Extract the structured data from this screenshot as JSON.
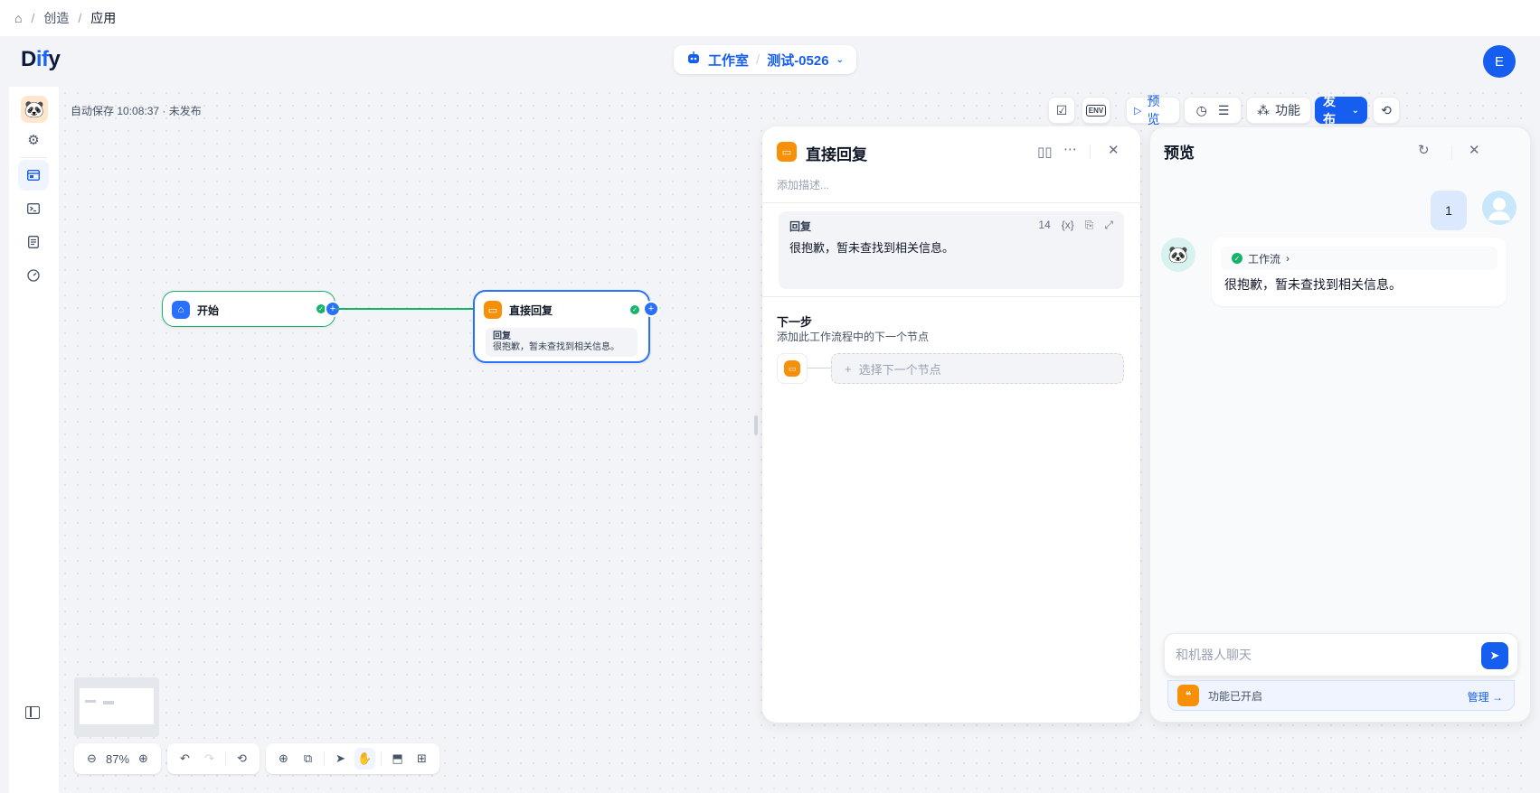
{
  "breadcrumb": {
    "home_icon": "home-icon",
    "items": [
      "创造",
      "应用"
    ]
  },
  "header": {
    "logo_pre": "D",
    "logo_accent": "if",
    "logo_post": "y",
    "studio_label": "工作室",
    "app_name": "测试-0526",
    "user_initial": "E"
  },
  "canvas": {
    "autosave_text": "自动保存 10:08:37 · 未发布"
  },
  "toolbar": {
    "env_label": "ENV",
    "preview_label": "预览",
    "features_label": "功能",
    "publish_label": "发布"
  },
  "nodes": {
    "start": {
      "title": "开始"
    },
    "reply": {
      "title": "直接回复",
      "body_label": "回复",
      "body_text": "很抱歉，暂未查找到相关信息。"
    }
  },
  "controls": {
    "zoom": "87%"
  },
  "node_panel": {
    "title": "直接回复",
    "desc_placeholder": "添加描述...",
    "reply_label": "回复",
    "reply_count": "14",
    "var_label": "{x}",
    "reply_text": "很抱歉，暂未查找到相关信息。",
    "next_title": "下一步",
    "next_sub": "添加此工作流程中的下一个节点",
    "next_btn": "选择下一个节点"
  },
  "preview": {
    "title": "预览",
    "user_message": "1",
    "workflow_tag": "工作流",
    "bot_message": "很抱歉，暂未查找到相关信息。",
    "input_placeholder": "和机器人聊天",
    "features_on": "功能已开启",
    "manage_label": "管理 →"
  },
  "colors": {
    "accent": "#155eef",
    "success": "#17b26a",
    "warning": "#f79009"
  }
}
